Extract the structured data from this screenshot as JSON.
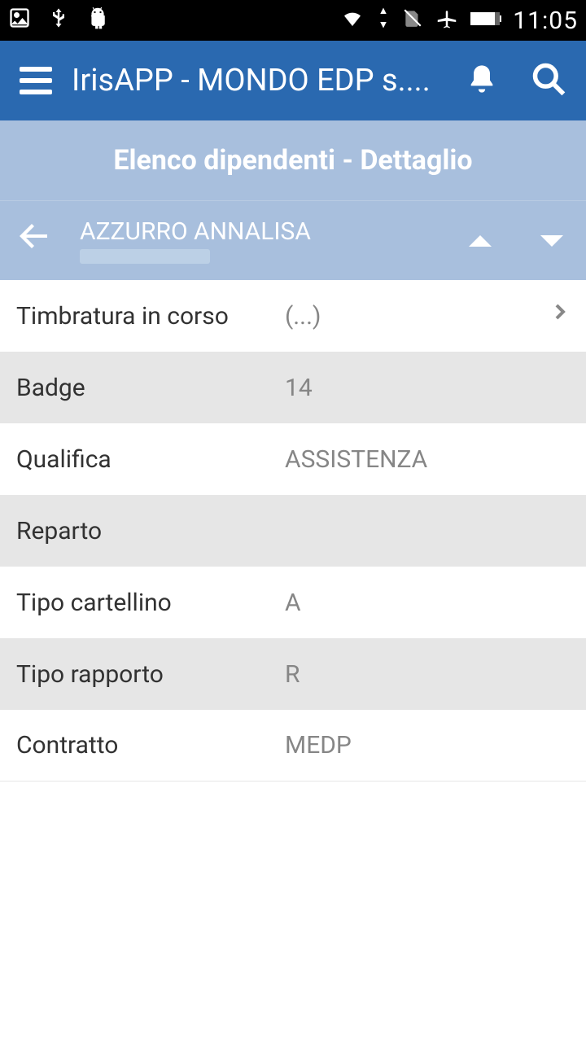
{
  "status": {
    "time": "11:05"
  },
  "appbar": {
    "title": "IrisAPP - MONDO EDP s...."
  },
  "section": {
    "title": "Elenco dipendenti - Dettaglio"
  },
  "employee": {
    "name": "AZZURRO ANNALISA"
  },
  "rows": [
    {
      "label": "Timbratura in corso",
      "value": "(...)",
      "nav": true
    },
    {
      "label": "Badge",
      "value": "14"
    },
    {
      "label": "Qualifica",
      "value": "ASSISTENZA"
    },
    {
      "label": "Reparto",
      "value": ""
    },
    {
      "label": "Tipo cartellino",
      "value": "A"
    },
    {
      "label": "Tipo rapporto",
      "value": "R"
    },
    {
      "label": "Contratto",
      "value": "MEDP"
    }
  ]
}
